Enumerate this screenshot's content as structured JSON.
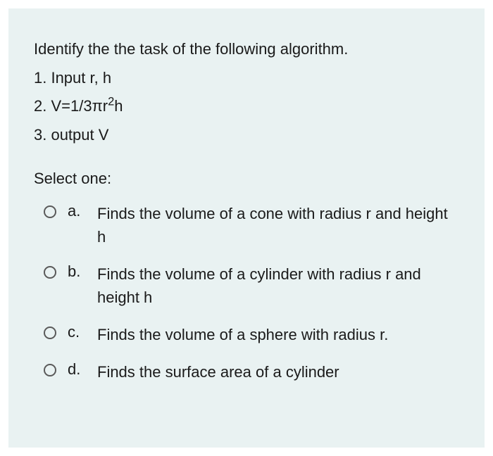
{
  "question": {
    "prompt": "Identify the the task of the following algorithm.",
    "steps": [
      "1. Input r, h",
      "2. V=1/3πr²h",
      "3. output V"
    ],
    "select_label": "Select one:",
    "options": [
      {
        "letter": "a.",
        "text": "Finds the  volume of a cone with radius r and height h"
      },
      {
        "letter": "b.",
        "text": "Finds the volume of a cylinder with radius r and height h"
      },
      {
        "letter": "c.",
        "text": "Finds the volume of a sphere with radius r."
      },
      {
        "letter": "d.",
        "text": "Finds the surface area of a cylinder"
      }
    ]
  }
}
